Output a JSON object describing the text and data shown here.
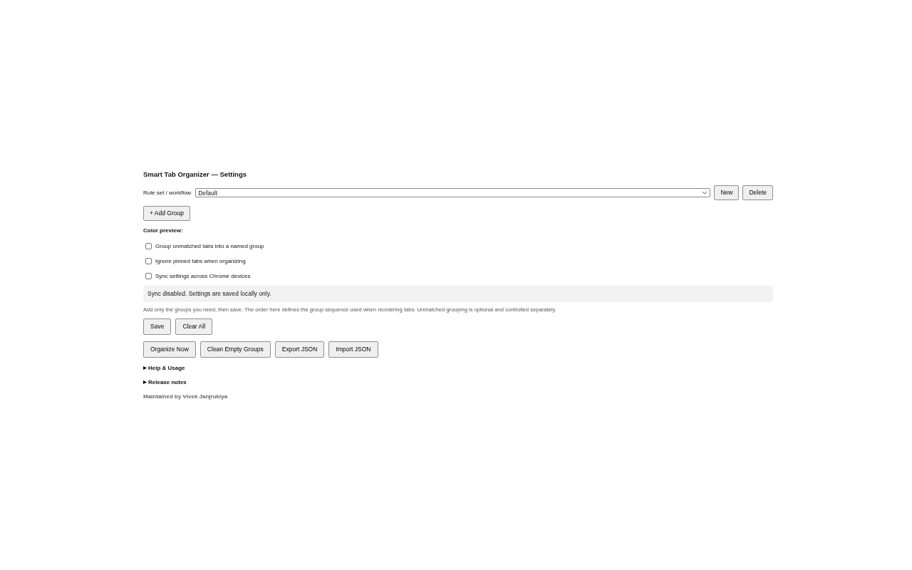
{
  "title": "Smart Tab Organizer — Settings",
  "rule_set": {
    "label": "Rule set / workflow",
    "value": "Default",
    "buttons": [
      "New",
      "Delete"
    ]
  },
  "add_group_button": "+ Add Group",
  "color_preview_label": "Color preview:",
  "options": [
    {
      "label": "Group unmatched tabs into a named group",
      "checked": false
    },
    {
      "label": "Ignore pinned tabs when organizing",
      "checked": false
    },
    {
      "label": "Sync settings across Chrome devices",
      "checked": false
    }
  ],
  "sync_status": "Sync disabled. Settings are saved locally only.",
  "help_text": "Add only the groups you need, then save. The order here defines the group sequence used when reordering tabs. Unmatched grouping is optional and controlled separately.",
  "primary_buttons": [
    "Save",
    "Clear All"
  ],
  "action_buttons": [
    "Organize Now",
    "Clean Empty Groups",
    "Export JSON",
    "Import JSON"
  ],
  "sections": [
    {
      "label": "Help & Usage",
      "expanded": false
    },
    {
      "label": "Release notes",
      "expanded": false
    }
  ],
  "footer": "Maintained by Vivek Janjrukiya"
}
